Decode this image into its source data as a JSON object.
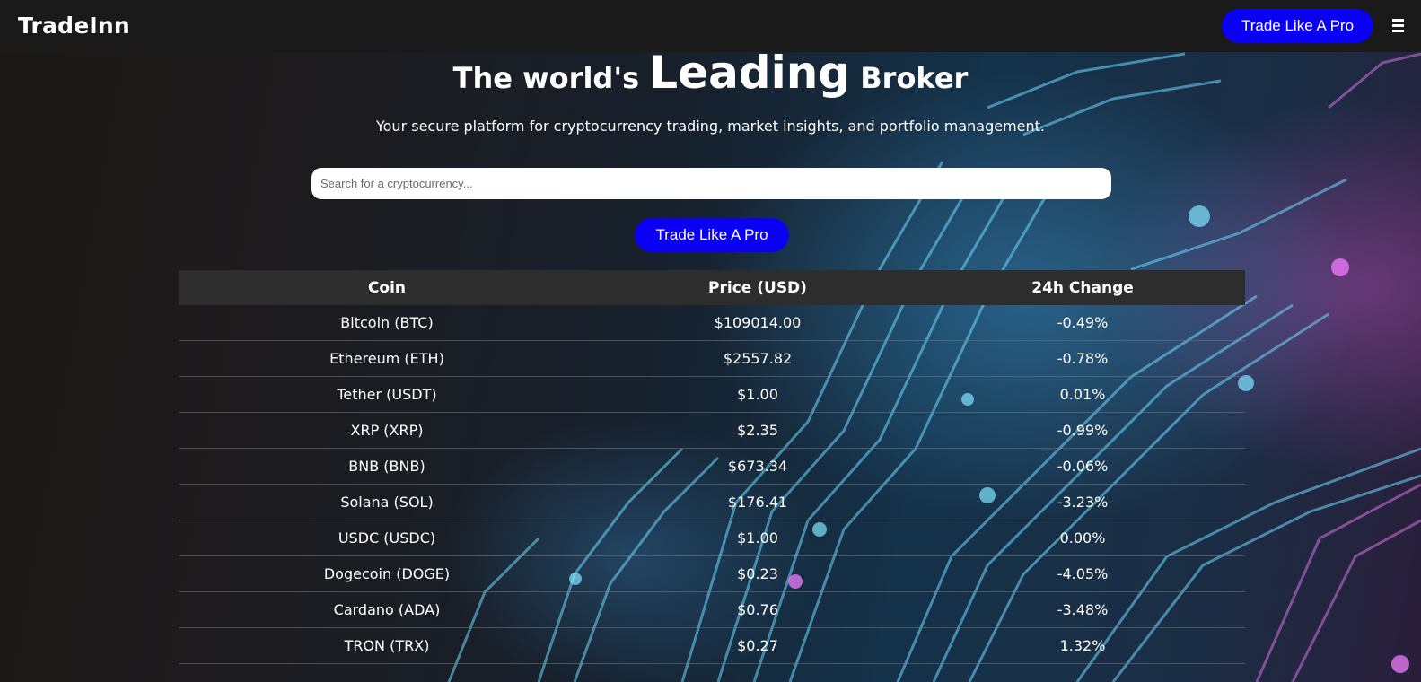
{
  "app": {
    "brand": "TradeInn",
    "nav_cta_label": "Trade Like A Pro",
    "menu_icon": "hamburger-icon"
  },
  "hero": {
    "title_part1": "The world's",
    "title_emphasis": "Leading",
    "title_part2": "Broker",
    "subtitle": "Your secure platform for cryptocurrency trading, market insights, and portfolio management.",
    "search_placeholder": "Search for a cryptocurrency...",
    "search_value": "",
    "cta_label": "Trade Like A Pro"
  },
  "table": {
    "headers": [
      "Coin",
      "Price (USD)",
      "24h Change"
    ],
    "rows": [
      {
        "coin": "Bitcoin (BTC)",
        "price": "$109014.00",
        "change": "-0.49%",
        "direction": "down"
      },
      {
        "coin": "Ethereum (ETH)",
        "price": "$2557.82",
        "change": "-0.78%",
        "direction": "down"
      },
      {
        "coin": "Tether (USDT)",
        "price": "$1.00",
        "change": "0.01%",
        "direction": "up"
      },
      {
        "coin": "XRP (XRP)",
        "price": "$2.35",
        "change": "-0.99%",
        "direction": "down"
      },
      {
        "coin": "BNB (BNB)",
        "price": "$673.34",
        "change": "-0.06%",
        "direction": "down"
      },
      {
        "coin": "Solana (SOL)",
        "price": "$176.41",
        "change": "-3.23%",
        "direction": "down"
      },
      {
        "coin": "USDC (USDC)",
        "price": "$1.00",
        "change": "0.00%",
        "direction": "up"
      },
      {
        "coin": "Dogecoin (DOGE)",
        "price": "$0.23",
        "change": "-4.05%",
        "direction": "down"
      },
      {
        "coin": "Cardano (ADA)",
        "price": "$0.76",
        "change": "-3.48%",
        "direction": "down"
      },
      {
        "coin": "TRON (TRX)",
        "price": "$0.27",
        "change": "1.32%",
        "direction": "up"
      }
    ]
  },
  "colors": {
    "accent_blue": "#0a00f4",
    "positive": "#19ff19",
    "negative": "#ff1a1a",
    "navbar_bg": "#1a1a1a",
    "table_header_bg": "#2d2d2d"
  }
}
